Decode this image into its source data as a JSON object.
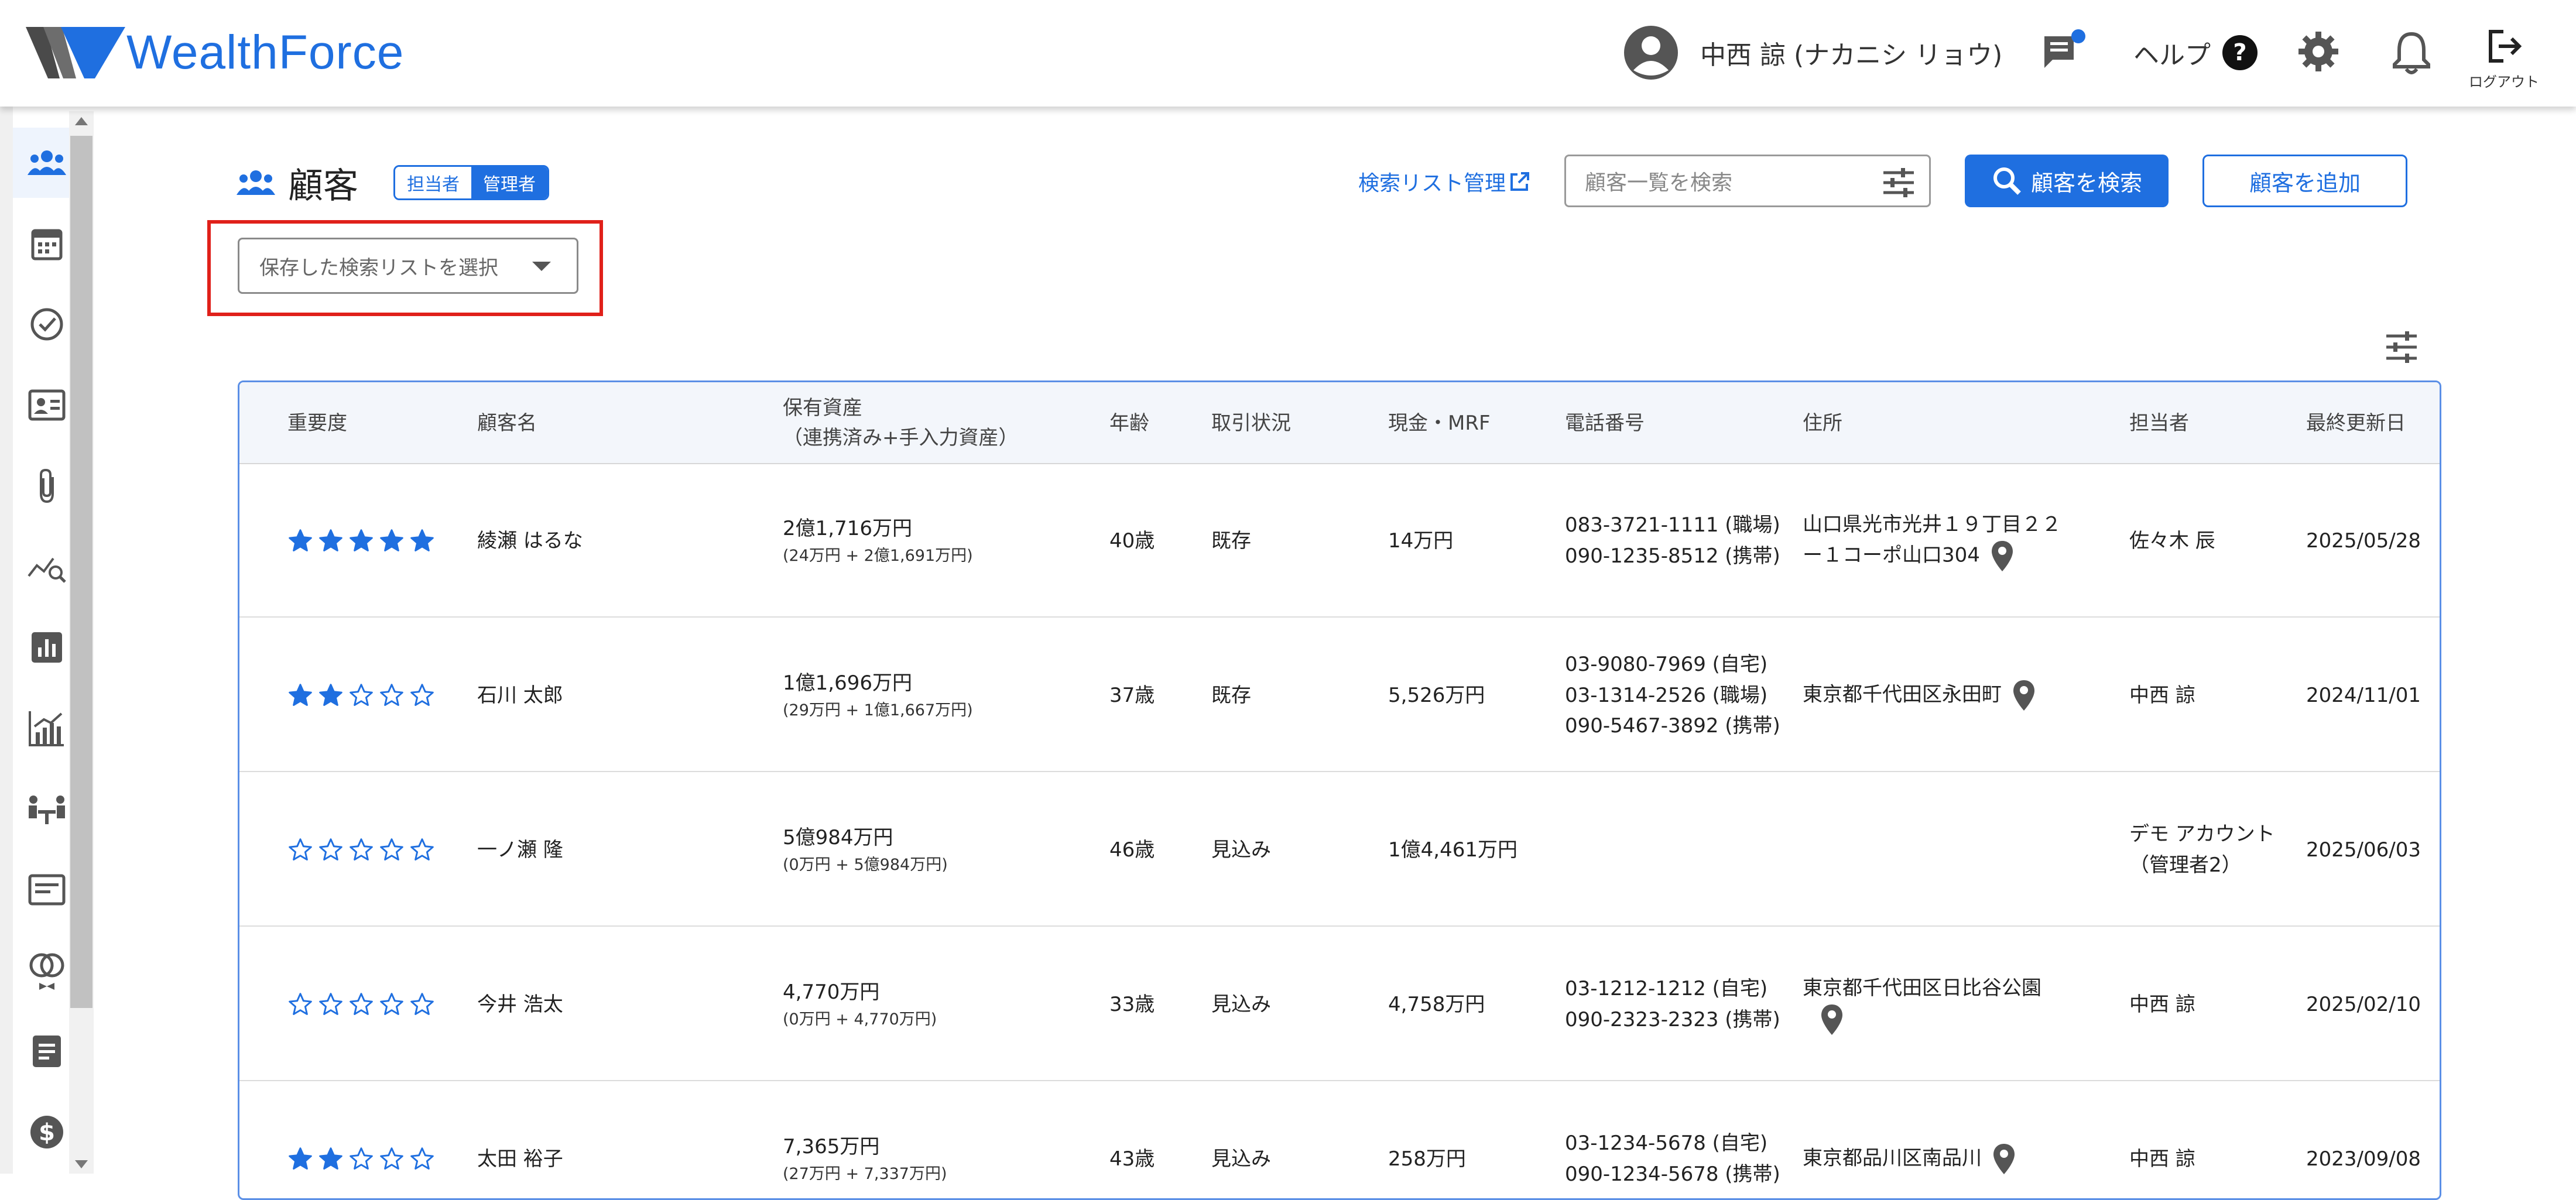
{
  "header": {
    "brand": "WealthForce",
    "user_name": "中西 諒 (ナカニシ リョウ)",
    "help_label": "ヘルプ",
    "logout_label": "ログアウト"
  },
  "sidebar": {
    "items": [
      {
        "icon": "users-icon",
        "active": true
      },
      {
        "icon": "calendar-icon"
      },
      {
        "icon": "check-circle-icon"
      },
      {
        "icon": "contact-card-icon"
      },
      {
        "icon": "paperclip-icon"
      },
      {
        "icon": "chart-search-icon"
      },
      {
        "icon": "bar-chart-icon"
      },
      {
        "icon": "analytics-icon"
      },
      {
        "icon": "meeting-icon"
      },
      {
        "icon": "card-icon"
      },
      {
        "icon": "rings-icon"
      },
      {
        "icon": "document-icon"
      },
      {
        "icon": "dollar-icon"
      }
    ]
  },
  "page": {
    "title": "顧客",
    "toggle": {
      "left": "担当者",
      "right": "管理者"
    },
    "saved_list_placeholder": "保存した検索リストを選択",
    "list_management": "検索リスト管理",
    "search_placeholder": "顧客一覧を検索",
    "search_button": "顧客を検索",
    "add_button": "顧客を追加"
  },
  "table": {
    "headers": {
      "importance": "重要度",
      "name": "顧客名",
      "assets_line1": "保有資産",
      "assets_line2": "（連携済み+手入力資産）",
      "age": "年齢",
      "status": "取引状況",
      "cash": "現金・MRF",
      "phone": "電話番号",
      "address": "住所",
      "owner": "担当者",
      "updated": "最終更新日"
    },
    "rows": [
      {
        "stars": 5,
        "name": "綾瀬 はるな",
        "assets": "2億1,716万円",
        "assets_detail": "(24万円 + 2億1,691万円)",
        "age": "40歳",
        "status": "既存",
        "cash": "14万円",
        "phones": [
          "083-3721-1111 (職場)",
          "090-1235-8512 (携帯)"
        ],
        "address_line1": "山口県光市光井１９丁目２２",
        "address_line2": "ー１コーポ山口304",
        "owner_line1": "佐々木 辰",
        "owner_line2": "",
        "updated": "2025/05/28"
      },
      {
        "stars": 2,
        "name": "石川 太郎",
        "assets": "1億1,696万円",
        "assets_detail": "(29万円 + 1億1,667万円)",
        "age": "37歳",
        "status": "既存",
        "cash": "5,526万円",
        "phones": [
          "03-9080-7969 (自宅)",
          "03-1314-2526 (職場)",
          "090-5467-3892 (携帯)"
        ],
        "address_line1": "東京都千代田区永田町",
        "address_line2": "",
        "owner_line1": "中西 諒",
        "owner_line2": "",
        "updated": "2024/11/01"
      },
      {
        "stars": 0,
        "name": "一ノ瀬 隆",
        "assets": "5億984万円",
        "assets_detail": "(0万円 + 5億984万円)",
        "age": "46歳",
        "status": "見込み",
        "cash": "1億4,461万円",
        "phones": [],
        "address_line1": "",
        "address_line2": "",
        "owner_line1": "デモ アカウント",
        "owner_line2": "（管理者2）",
        "updated": "2025/06/03"
      },
      {
        "stars": 0,
        "name": "今井 浩太",
        "assets": "4,770万円",
        "assets_detail": "(0万円 + 4,770万円)",
        "age": "33歳",
        "status": "見込み",
        "cash": "4,758万円",
        "phones": [
          "03-1212-1212 (自宅)",
          "090-2323-2323 (携帯)"
        ],
        "address_line1": "東京都千代田区日比谷公園",
        "address_line2": "",
        "owner_line1": "中西 諒",
        "owner_line2": "",
        "updated": "2025/02/10"
      },
      {
        "stars": 2,
        "name": "太田 裕子",
        "assets": "7,365万円",
        "assets_detail": "(27万円 + 7,337万円)",
        "age": "43歳",
        "status": "見込み",
        "cash": "258万円",
        "phones": [
          "03-1234-5678 (自宅)",
          "090-1234-5678 (携帯)"
        ],
        "address_line1": "東京都品川区南品川",
        "address_line2": "",
        "owner_line1": "中西 諒",
        "owner_line2": "",
        "updated": "2023/09/08"
      }
    ]
  },
  "colors": {
    "accent": "#1f6fe0",
    "highlight": "#e0201a",
    "pin": "#555555"
  }
}
